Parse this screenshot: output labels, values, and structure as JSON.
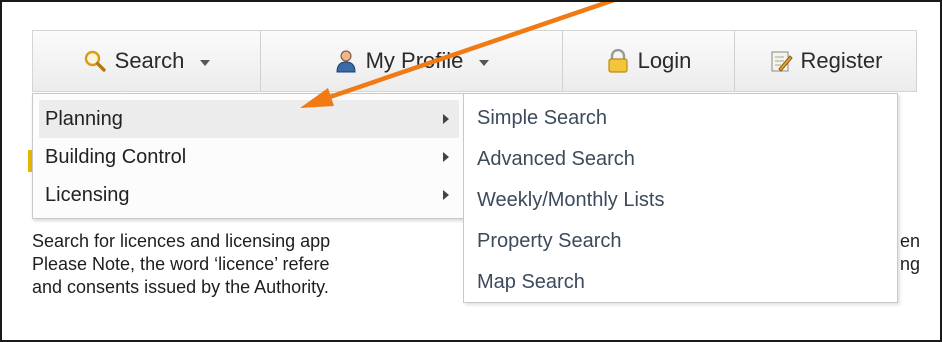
{
  "nav": {
    "items": [
      {
        "label": "Search",
        "icon": "magnifier-icon",
        "has_caret": true
      },
      {
        "label": "My Profile",
        "icon": "user-icon",
        "has_caret": true
      },
      {
        "label": "Login",
        "icon": "lock-icon",
        "has_caret": false
      },
      {
        "label": "Register",
        "icon": "edit-icon",
        "has_caret": false
      }
    ]
  },
  "dropdown": {
    "items": [
      {
        "label": "Planning",
        "active": true
      },
      {
        "label": "Building Control",
        "active": false
      },
      {
        "label": "Licensing",
        "active": false
      }
    ]
  },
  "submenu": {
    "items": [
      {
        "label": "Simple Search"
      },
      {
        "label": "Advanced Search"
      },
      {
        "label": "Weekly/Monthly Lists"
      },
      {
        "label": "Property Search"
      },
      {
        "label": "Map Search"
      }
    ]
  },
  "background_text": {
    "line1": "Search for licences and licensing app",
    "line2": "Please Note, the word ‘licence’ refere",
    "line3": "and consents issued by the Authority.",
    "line1_tail": "en",
    "line2_tail": "ng"
  },
  "colors": {
    "annotation_arrow": "#f07a14",
    "submenu_text": "#3c4a5c",
    "accent_mark": "#e5b800"
  }
}
